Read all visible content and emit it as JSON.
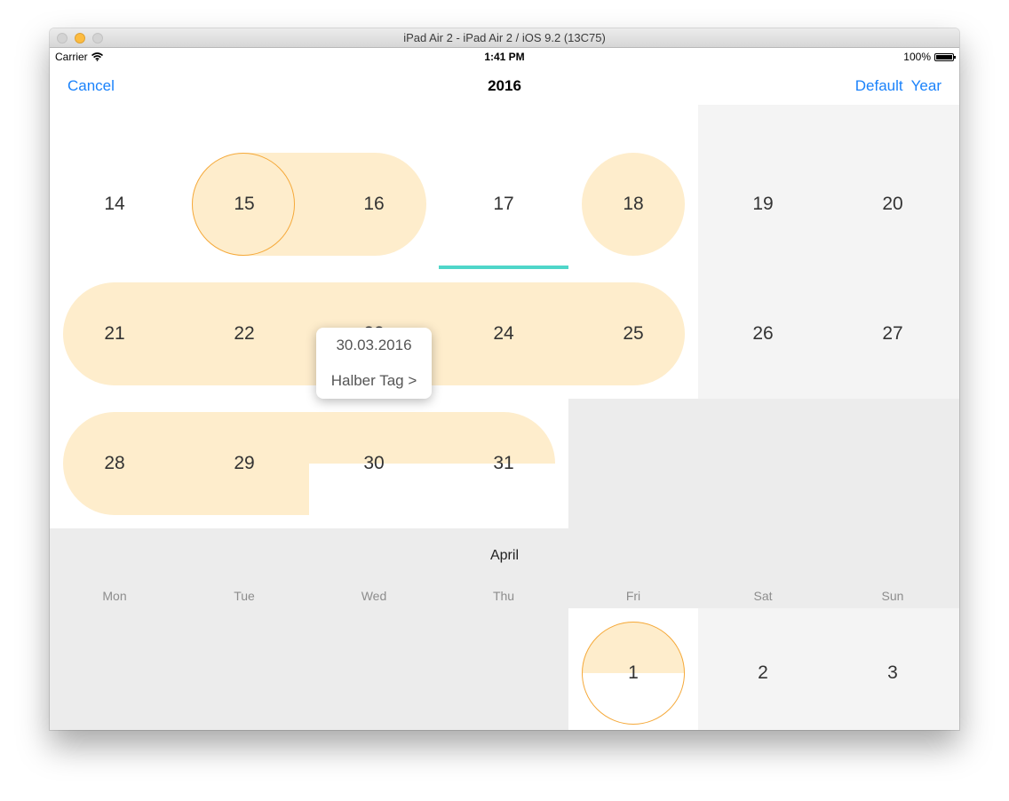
{
  "window": {
    "title": "iPad Air 2 - iPad Air 2 / iOS 9.2 (13C75)"
  },
  "statusbar": {
    "carrier": "Carrier",
    "time": "1:41 PM",
    "battery": "100%"
  },
  "navbar": {
    "cancel": "Cancel",
    "title": "2016",
    "default": "Default",
    "year": "Year"
  },
  "calendar": {
    "march_week1": [
      "14",
      "15",
      "16",
      "17",
      "18",
      "19",
      "20"
    ],
    "march_week2": [
      "21",
      "22",
      "23",
      "24",
      "25",
      "26",
      "27"
    ],
    "march_week3": [
      "28",
      "29",
      "30",
      "31"
    ],
    "april": {
      "month": "April",
      "weekdays": [
        "Mon",
        "Tue",
        "Wed",
        "Thu",
        "Fri",
        "Sat",
        "Sun"
      ],
      "week1": [
        "1",
        "2",
        "3"
      ]
    }
  },
  "popover": {
    "date": "30.03.2016",
    "action": "Halber Tag >"
  },
  "colors": {
    "accent": "#1a82fb",
    "vacation_fill": "#feedcc",
    "selected_ring": "#f5a93a",
    "today_underline": "#4fd6c9",
    "weekend_bg": "#f4f4f4",
    "empty_bg": "#ececec"
  },
  "icons": {
    "wifi": "wifi-icon",
    "battery": "battery-icon"
  }
}
